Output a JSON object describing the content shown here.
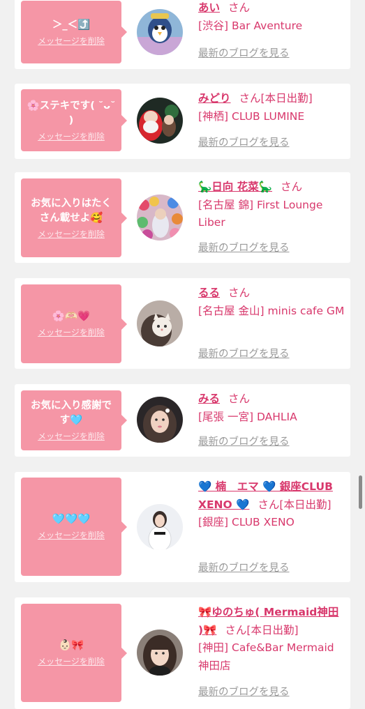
{
  "delete_label": "メッセージを削除",
  "blog_label": "最新のブログを見る",
  "san_label": "さん",
  "colors": {
    "accent": "#d8386c",
    "bubble": "#f596a6",
    "background": "#f1f1f1"
  },
  "items": [
    {
      "message": "＞_＜⤴️",
      "name": "あい",
      "extra": "",
      "shop": "[渋谷] Bar Aventure",
      "avatar": "penguin-character-avatar"
    },
    {
      "message": "🌸ステキです( ˘ᴗ˘ )",
      "name": "みどり",
      "extra": "[本日出勤]",
      "shop": "[神栖] CLUB LUMINE",
      "avatar": "santa-photo-avatar"
    },
    {
      "message": "お気に入りはたくさん載せよ🥰",
      "name": "🦕日向 花菜🦕",
      "extra": "",
      "shop": "[名古屋 錦] First Lounge Liber",
      "avatar": "balloons-photo-avatar"
    },
    {
      "message": "🌸🫶🏻💗",
      "name": "るる",
      "extra": "",
      "shop": "[名古屋 金山] minis cafe GM",
      "avatar": "cat-filter-photo-avatar"
    },
    {
      "message": "お気に入り感謝です🩵",
      "name": "みる",
      "extra": "",
      "shop": "[尾張 一宮] DAHLIA",
      "avatar": "woman-photo-avatar"
    },
    {
      "message": "🩵🩵🩵",
      "name": "💙 楠　エマ 💙 銀座CLUB XENO 💙",
      "extra": "[本日出勤]",
      "shop": "[銀座] CLUB XENO",
      "avatar": "woman-white-dress-avatar"
    },
    {
      "message": "👶🏻🎀",
      "name": "🎀ゆのちゅ( Mermaid神田 )🎀",
      "extra": "[本日出勤]",
      "shop": "[神田] Cafe&Bar Mermaid神田店",
      "avatar": "woman-bangs-photo-avatar"
    }
  ]
}
